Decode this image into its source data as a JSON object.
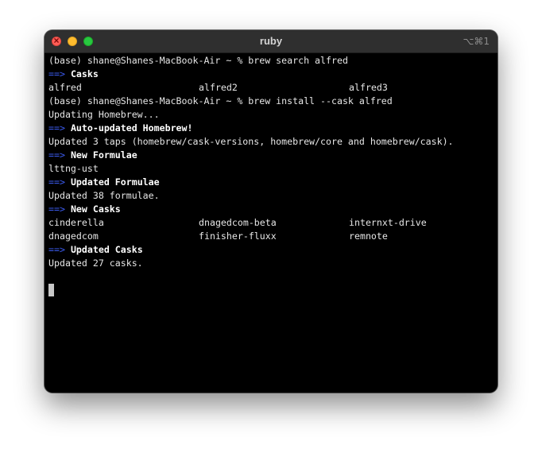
{
  "window": {
    "title": "ruby",
    "shortcut": "⌥⌘1"
  },
  "terminal": {
    "arrow": "==>",
    "lines": [
      {
        "kind": "text",
        "text": "(base) shane@Shanes-MacBook-Air ~ % brew search alfred"
      },
      {
        "kind": "header",
        "text": "Casks"
      },
      {
        "kind": "cols",
        "cols": [
          "alfred",
          "alfred2",
          "alfred3"
        ]
      },
      {
        "kind": "text",
        "text": "(base) shane@Shanes-MacBook-Air ~ % brew install --cask alfred"
      },
      {
        "kind": "text",
        "text": "Updating Homebrew..."
      },
      {
        "kind": "header",
        "text": "Auto-updated Homebrew!"
      },
      {
        "kind": "text",
        "text": "Updated 3 taps (homebrew/cask-versions, homebrew/core and homebrew/cask)."
      },
      {
        "kind": "header",
        "text": "New Formulae"
      },
      {
        "kind": "text",
        "text": "lttng-ust"
      },
      {
        "kind": "header",
        "text": "Updated Formulae"
      },
      {
        "kind": "text",
        "text": "Updated 38 formulae."
      },
      {
        "kind": "header",
        "text": "New Casks"
      },
      {
        "kind": "cols",
        "cols": [
          "cinderella",
          "dnagedcom-beta",
          "internxt-drive"
        ]
      },
      {
        "kind": "cols",
        "cols": [
          "dnagedcom",
          "finisher-fluxx",
          "remnote"
        ]
      },
      {
        "kind": "header",
        "text": "Updated Casks"
      },
      {
        "kind": "text",
        "text": "Updated 27 casks."
      },
      {
        "kind": "blank",
        "text": ""
      },
      {
        "kind": "cursor",
        "text": ""
      }
    ]
  }
}
